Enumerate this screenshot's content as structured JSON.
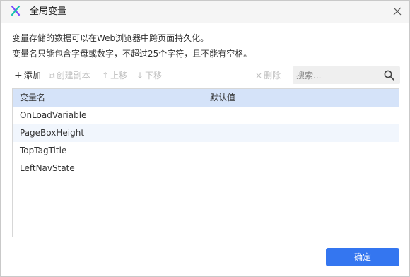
{
  "dialog": {
    "title": "全局变量",
    "description_line1": "变量存储的数据可以在Web浏览器中跨页面持久化。",
    "description_line2": "变量名只能包含字母或数字，不超过25个字符，且不能有空格。"
  },
  "toolbar": {
    "add_label": "添加",
    "add_icon": "+",
    "copy_label": "创建副本",
    "copy_icon": "⧉",
    "up_label": "上移",
    "up_icon": "↑",
    "down_label": "下移",
    "down_icon": "↓",
    "delete_label": "删除",
    "delete_icon": "×"
  },
  "search": {
    "placeholder": "搜索..."
  },
  "table": {
    "columns": [
      "变量名",
      "默认值"
    ],
    "rows": [
      {
        "name": "OnLoadVariable",
        "default": ""
      },
      {
        "name": "PageBoxHeight",
        "default": ""
      },
      {
        "name": "TopTagTitle",
        "default": ""
      },
      {
        "name": "LeftNavState",
        "default": ""
      }
    ]
  },
  "footer": {
    "ok_label": "确定"
  },
  "colors": {
    "accent": "#3476f0",
    "header_bg": "#d5e3f9",
    "row_alt_bg": "#f1f6fd",
    "logo_purple": "#7b4dff",
    "logo_teal": "#19c2b0"
  }
}
